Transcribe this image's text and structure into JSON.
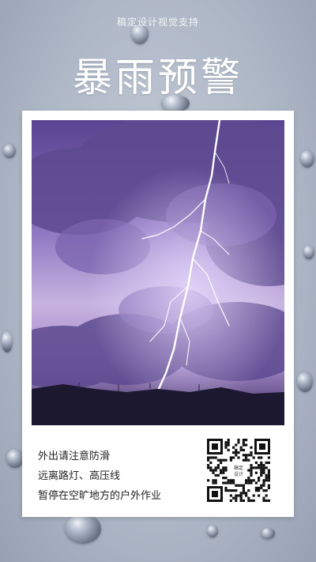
{
  "watermark": "稿定设计视觉支持",
  "title": "暴雨预警",
  "tips": [
    "外出请注意防滑",
    "远离路灯、高压线",
    "暂停在空旷地方的户外作业"
  ],
  "qr": {
    "icon": "qr-code-icon",
    "caption_line1": "稿定",
    "caption_line2": "设计"
  },
  "colors": {
    "background": "#b4bcc9",
    "sky": "#7a5fae",
    "card": "#ffffff"
  }
}
